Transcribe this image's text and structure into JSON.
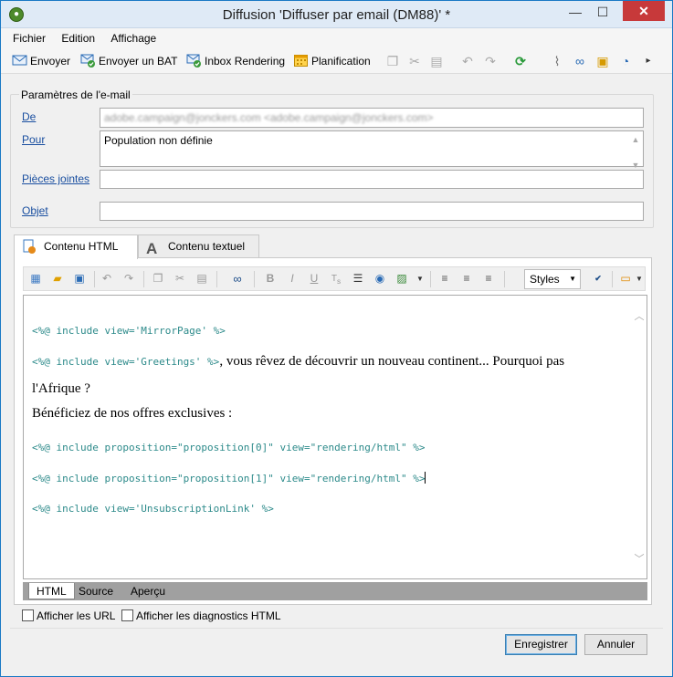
{
  "window": {
    "title": "Diffusion 'Diffuser par email (DM88)' *",
    "controls": {
      "minimize": "—",
      "maximize": "☐",
      "close": "✕"
    }
  },
  "menu": [
    "Fichier",
    "Edition",
    "Affichage"
  ],
  "toolbar": {
    "send": "Envoyer",
    "send_proof": "Envoyer un BAT",
    "inbox_rendering": "Inbox Rendering",
    "planning": "Planification"
  },
  "email_params": {
    "legend": "Paramètres de l'e-mail",
    "from_label": "De",
    "from_value": "adobe.campaign@jonckers.com <adobe.campaign@jonckers.com>",
    "to_label": "Pour",
    "to_value": "Population non définie",
    "attachments_label": "Pièces jointes",
    "attachments_value": "",
    "subject_label": "Objet",
    "subject_value": ""
  },
  "content_tabs": [
    {
      "label": "Contenu HTML",
      "active": true
    },
    {
      "label": "Contenu textuel",
      "active": false
    }
  ],
  "editor_toolbar": {
    "styles": "Styles"
  },
  "editor": {
    "lines": [
      {
        "type": "code",
        "text": "<%@ include view='MirrorPage' %>"
      },
      {
        "type": "code",
        "text": "<%@ include view='Greetings' %>"
      },
      {
        "type": "prose",
        "text": ", vous rêvez de découvrir un nouveau continent... Pourquoi pas"
      },
      {
        "type": "prose",
        "text": "l'Afrique ?"
      },
      {
        "type": "prose",
        "text": "Bénéficiez de nos offres exclusives :"
      },
      {
        "type": "code",
        "text": "<%@ include proposition=\"proposition[0]\" view=\"rendering/html\" %>"
      },
      {
        "type": "code",
        "text": "<%@ include proposition=\"proposition[1]\" view=\"rendering/html\" %>"
      },
      {
        "type": "code",
        "text": "<%@ include view='UnsubscriptionLink' %>"
      }
    ]
  },
  "bottom_tabs": [
    {
      "label": "HTML",
      "active": true
    },
    {
      "label": "Source",
      "active": false
    },
    {
      "label": "Aperçu",
      "active": false
    }
  ],
  "options": {
    "show_urls": "Afficher les URL",
    "show_diagnostics": "Afficher les diagnostics HTML"
  },
  "buttons": {
    "save": "Enregistrer",
    "cancel": "Annuler"
  },
  "colors": {
    "titlebar": "#dfeaf6",
    "close": "#c7393a",
    "code": "#2c8a8a",
    "link": "#1a4fa0"
  },
  "icons": [
    "app-icon",
    "envelope-icon",
    "envelope-check-icon",
    "calendar-icon",
    "copy-icon",
    "cut-icon",
    "paste-icon",
    "undo-icon",
    "redo-icon",
    "refresh-icon",
    "paperclip-icon",
    "link-icon",
    "gift-icon",
    "tracking-icon",
    "binoculars-icon",
    "bold-icon",
    "italic-icon",
    "underline-icon",
    "strike-icon",
    "list-icon",
    "globe-link-icon",
    "image-icon",
    "align-left-icon",
    "align-center-icon",
    "align-right-icon",
    "spellcheck-icon",
    "layout-icon"
  ]
}
